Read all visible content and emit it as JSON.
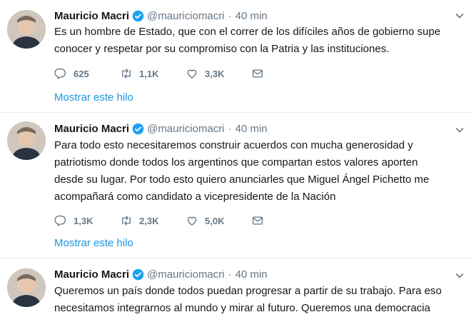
{
  "colors": {
    "accent": "#1da1f2",
    "link": "#1b95e0",
    "muted": "#657786",
    "divider": "#e6ecf0"
  },
  "tweets": [
    {
      "author": {
        "name": "Mauricio Macri",
        "handle": "@mauriciomacri",
        "verified": true
      },
      "time": "40 min",
      "lines": [
        "Es un hombre de Estado, que con el correr de los difíciles años de gobierno supe",
        "conocer y respetar por su compromiso con la Patria y las instituciones."
      ],
      "replies": "625",
      "retweets": "1,1K",
      "likes": "3,3K",
      "thread_link": "Mostrar este hilo"
    },
    {
      "author": {
        "name": "Mauricio Macri",
        "handle": "@mauriciomacri",
        "verified": true
      },
      "time": "40 min",
      "lines": [
        "Para todo esto necesitaremos construir acuerdos con mucha generosidad y",
        "patriotismo donde todos los argentinos que compartan estos valores aporten",
        "desde su lugar. Por todo esto quiero anunciarles que Miguel Ángel Pichetto me",
        "acompañará como candidato a vicepresidente de la Nación"
      ],
      "replies": "1,3K",
      "retweets": "2,3K",
      "likes": "5,0K",
      "thread_link": "Mostrar este hilo"
    },
    {
      "author": {
        "name": "Mauricio Macri",
        "handle": "@mauriciomacri",
        "verified": true
      },
      "time": "40 min",
      "lines": [
        "Queremos un país donde todos puedan progresar a partir de su trabajo. Para eso",
        "necesitamos integrarnos al mundo y mirar al futuro. Queremos una democracia"
      ]
    }
  ]
}
